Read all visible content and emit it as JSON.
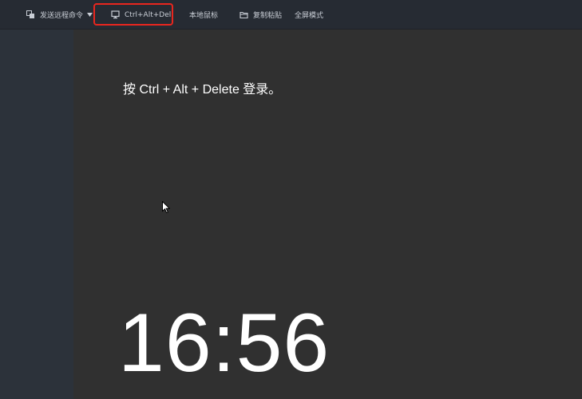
{
  "toolbar": {
    "send_command_label": "发送远程命令",
    "ctrl_alt_del_label": "Ctrl+Alt+Del",
    "local_mouse_label": "本地鼠标",
    "copy_paste_label": "复制粘贴",
    "fullscreen_label": "全屏模式",
    "icons": {
      "send_command": "commands-icon",
      "ctrl_alt_del": "monitor-icon",
      "copy_paste": "folder-icon",
      "dropdown": "caret-down-icon"
    }
  },
  "remote_screen": {
    "login_prompt": "按 Ctrl + Alt + Delete 登录。",
    "clock": "16:56"
  },
  "colors": {
    "toolbar_bg": "#262b33",
    "screen_bg": "#303030",
    "highlight": "#e8261e",
    "toolbar_text": "#c9ced6"
  }
}
